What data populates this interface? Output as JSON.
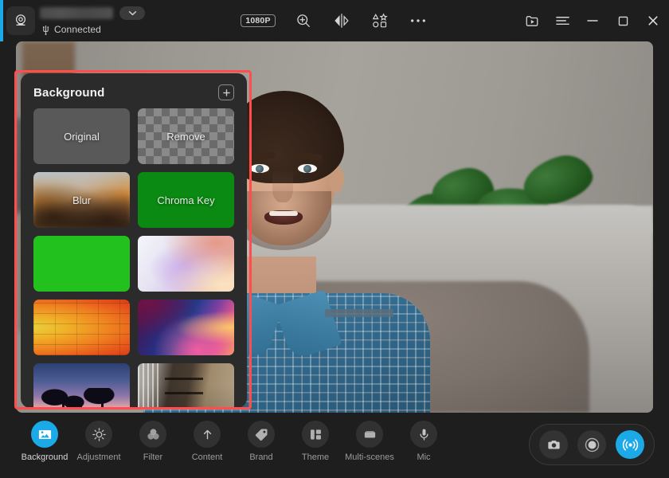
{
  "app": {
    "accent_color": "#1ba9e8",
    "panel_bg": "#2b2b2b",
    "window_bg": "#1e1e1e",
    "annotation_color": "#ff4d4d"
  },
  "titlebar": {
    "device_icon": "webcam-icon",
    "device_name_redacted": "",
    "dropdown_icon": "chevron-down-icon",
    "usb_icon": "usb-icon",
    "connection_status": "Connected",
    "center_tools": [
      {
        "name": "resolution-badge",
        "label": "1080P",
        "icon": ""
      },
      {
        "name": "zoom-in-button",
        "label": "",
        "icon": "zoom-in-icon"
      },
      {
        "name": "mirror-button",
        "label": "",
        "icon": "mirror-flip-icon"
      },
      {
        "name": "stickers-button",
        "label": "",
        "icon": "shapes-stickers-icon"
      },
      {
        "name": "more-options-button",
        "label": "",
        "icon": "more-ellipsis-icon"
      }
    ],
    "window_tools": [
      {
        "name": "media-library-button",
        "icon": "media-folder-play-icon"
      },
      {
        "name": "menu-button",
        "icon": "hamburger-menu-icon"
      },
      {
        "name": "minimize-button",
        "icon": "minimize-icon"
      },
      {
        "name": "maximize-button",
        "icon": "maximize-icon"
      },
      {
        "name": "close-button",
        "icon": "close-icon"
      }
    ]
  },
  "background_panel": {
    "title": "Background",
    "add_button_icon": "plus-icon",
    "tiles": [
      {
        "label": "Original",
        "style": "t-original",
        "name": "background-tile-original"
      },
      {
        "label": "Remove",
        "style": "t-remove",
        "name": "background-tile-remove"
      },
      {
        "label": "Blur",
        "style": "t-blur",
        "name": "background-tile-blur"
      },
      {
        "label": "Chroma Key",
        "style": "t-chroma",
        "name": "background-tile-chroma-key"
      },
      {
        "label": "",
        "style": "t-green",
        "name": "background-tile-green-screen"
      },
      {
        "label": "",
        "style": "t-pastel",
        "name": "background-tile-pastel-gradient"
      },
      {
        "label": "",
        "style": "t-brick",
        "name": "background-tile-orange-brick"
      },
      {
        "label": "",
        "style": "t-neon",
        "name": "background-tile-neon-gradient"
      },
      {
        "label": "",
        "style": "t-palm",
        "name": "background-tile-palm-trees"
      },
      {
        "label": "",
        "style": "t-room",
        "name": "background-tile-interior-room"
      }
    ]
  },
  "preview": {
    "name": "video-preview",
    "description": "Live webcam preview of a person in a plaid shirt in a living room"
  },
  "bottom_nav": [
    {
      "label": "Background",
      "icon": "image-icon",
      "active": true,
      "name": "nav-background"
    },
    {
      "label": "Adjustment",
      "icon": "brightness-icon",
      "active": false,
      "name": "nav-adjustment"
    },
    {
      "label": "Filter",
      "icon": "filter-circles-icon",
      "active": false,
      "name": "nav-filter"
    },
    {
      "label": "Content",
      "icon": "upload-arrow-icon",
      "active": false,
      "name": "nav-content"
    },
    {
      "label": "Brand",
      "icon": "tag-icon",
      "active": false,
      "name": "nav-brand"
    },
    {
      "label": "Theme",
      "icon": "layout-icon",
      "active": false,
      "name": "nav-theme"
    },
    {
      "label": "Multi-scenes",
      "icon": "scenes-icon",
      "active": false,
      "name": "nav-multi-scenes"
    },
    {
      "label": "Mic",
      "icon": "microphone-icon",
      "active": false,
      "name": "nav-mic"
    }
  ],
  "capture_controls": [
    {
      "name": "snapshot-button",
      "icon": "camera-icon",
      "active": false
    },
    {
      "name": "record-button",
      "icon": "record-dot-icon",
      "active": false
    },
    {
      "name": "broadcast-button",
      "icon": "broadcast-waves-icon",
      "active": true
    }
  ]
}
